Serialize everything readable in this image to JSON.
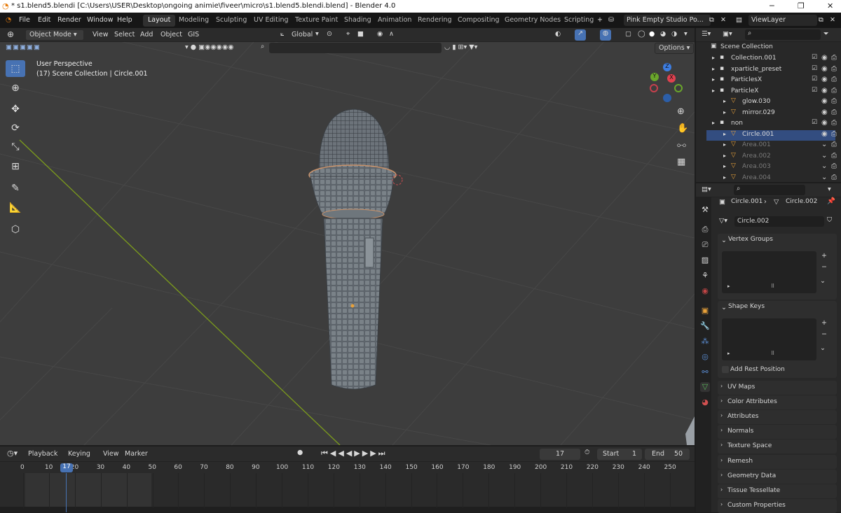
{
  "titlebar": {
    "title": "* s1.blend5.blendi [C:\\Users\\USER\\Desktop\\ongoing animie\\fiveer\\micro\\s1.blend5.blendi.blend] - Blender 4.0"
  },
  "menu": {
    "items": [
      "File",
      "Edit",
      "Render",
      "Window",
      "Help"
    ]
  },
  "workspaces": {
    "tabs": [
      "Layout",
      "Modeling",
      "Sculpting",
      "UV Editing",
      "Texture Paint",
      "Shading",
      "Animation",
      "Rendering",
      "Compositing",
      "Geometry Nodes",
      "Scripting"
    ],
    "active": "Layout",
    "add": "+"
  },
  "scene": {
    "name": "Pink Empty Studio Po...",
    "view_layer": "ViewLayer"
  },
  "viewport": {
    "mode": "Object Mode",
    "menus": [
      "View",
      "Select",
      "Add",
      "Object",
      "GIS"
    ],
    "orientation": "Global",
    "options": "Options",
    "overlay_title": "User Perspective",
    "overlay_sub": "(17) Scene Collection | Circle.001",
    "gizmo": {
      "x": "X",
      "y": "Y",
      "z": "Z"
    }
  },
  "outliner": {
    "root": "Scene Collection",
    "rows": [
      {
        "label": "Collection.001",
        "depth": 1,
        "dim": false
      },
      {
        "label": "xparticle_preset",
        "depth": 1,
        "dim": false
      },
      {
        "label": "ParticlesX",
        "depth": 1,
        "dim": false
      },
      {
        "label": "ParticleX",
        "depth": 1,
        "dim": false
      },
      {
        "label": "glow.030",
        "depth": 2,
        "dim": false
      },
      {
        "label": "mirror.029",
        "depth": 2,
        "dim": false
      },
      {
        "label": "non",
        "depth": 1,
        "dim": false
      },
      {
        "label": "Circle.001",
        "depth": 2,
        "dim": false
      },
      {
        "label": "Area.001",
        "depth": 2,
        "dim": true
      },
      {
        "label": "Area.002",
        "depth": 2,
        "dim": true
      },
      {
        "label": "Area.003",
        "depth": 2,
        "dim": true
      },
      {
        "label": "Area.004",
        "depth": 2,
        "dim": true
      }
    ]
  },
  "properties": {
    "breadcrumb_object": "Circle.001",
    "breadcrumb_data": "Circle.002",
    "data_name": "Circle.002",
    "vertex_groups": "Vertex Groups",
    "shape_keys": "Shape Keys",
    "add_rest_position": "Add Rest Position",
    "panels": [
      "UV Maps",
      "Color Attributes",
      "Attributes",
      "Normals",
      "Texture Space",
      "Remesh",
      "Geometry Data",
      "Tissue Tessellate",
      "Custom Properties"
    ]
  },
  "timeline": {
    "menus": [
      "Playback",
      "Keying",
      "View",
      "Marker"
    ],
    "current_frame": "17",
    "start_label": "Start",
    "start": "1",
    "end_label": "End",
    "end": "50",
    "ticks": [
      "0",
      "10",
      "20",
      "30",
      "40",
      "50",
      "60",
      "70",
      "80",
      "90",
      "100",
      "110",
      "120",
      "130",
      "140",
      "150",
      "160",
      "170",
      "180",
      "190",
      "200",
      "210",
      "220",
      "230",
      "240",
      "250"
    ],
    "playhead": "17"
  },
  "colors": {
    "accent": "#4772b3",
    "mesh_origin": "#e8a13a",
    "x_axis": "#e0414f",
    "y_axis": "#6aa62b",
    "z_axis": "#3d7de0"
  }
}
